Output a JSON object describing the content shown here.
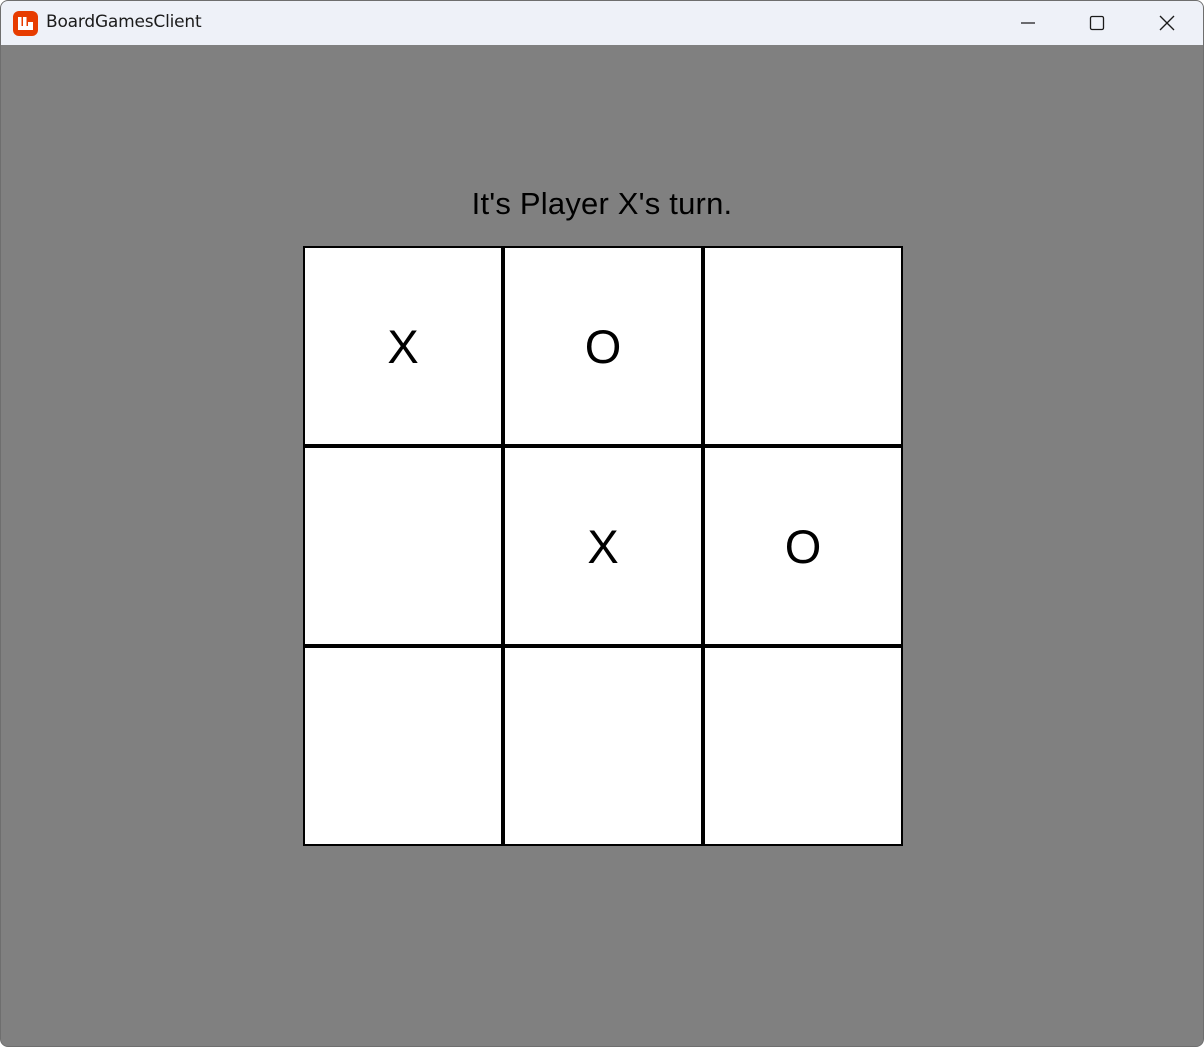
{
  "window": {
    "title": "BoardGamesClient",
    "app_icon": "monogame-logo-icon",
    "controls": {
      "minimize": "minimize-icon",
      "maximize": "maximize-icon",
      "close": "close-icon"
    }
  },
  "game": {
    "status": "It's Player X's turn.",
    "board": [
      [
        "X",
        "O",
        ""
      ],
      [
        "",
        "X",
        "O"
      ],
      [
        "",
        "",
        ""
      ]
    ]
  },
  "colors": {
    "background": "#808080",
    "cell": "#ffffff",
    "grid_line": "#000000",
    "icon_accent": "#e73c00"
  }
}
